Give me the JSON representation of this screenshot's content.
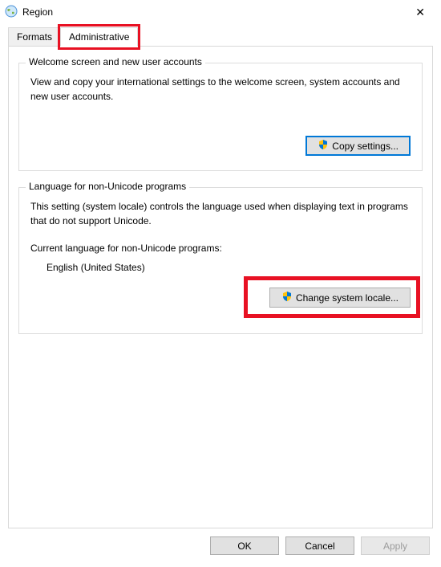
{
  "window": {
    "title": "Region",
    "close_label": "✕"
  },
  "tabs": {
    "formats": "Formats",
    "administrative": "Administrative"
  },
  "group1": {
    "legend": "Welcome screen and new user accounts",
    "desc": "View and copy your international settings to the welcome screen, system accounts and new user accounts.",
    "button": "Copy settings..."
  },
  "group2": {
    "legend": "Language for non-Unicode programs",
    "desc": "This setting (system locale) controls the language used when displaying text in programs that do not support Unicode.",
    "current_label": "Current language for non-Unicode programs:",
    "current_value": "English (United States)",
    "button": "Change system locale..."
  },
  "footer": {
    "ok": "OK",
    "cancel": "Cancel",
    "apply": "Apply"
  }
}
